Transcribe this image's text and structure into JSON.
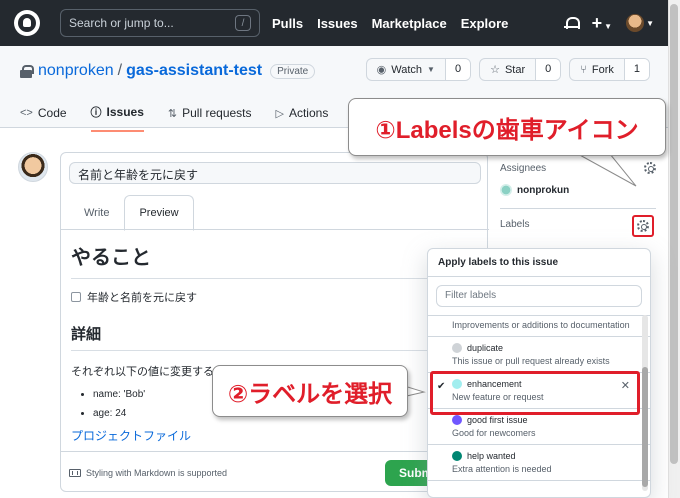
{
  "header": {
    "search_placeholder": "Search or jump to...",
    "search_key": "/",
    "nav": [
      "Pulls",
      "Issues",
      "Marketplace",
      "Explore"
    ],
    "plus": "+"
  },
  "repo": {
    "owner": "nonproken",
    "separator": "/",
    "name": "gas-assistant-test",
    "visibility": "Private",
    "watch_label": "Watch",
    "watch_count": "0",
    "star_label": "Star",
    "star_count": "0",
    "fork_label": "Fork",
    "fork_count": "1",
    "tabs": [
      {
        "label": "Code",
        "icon": "<>"
      },
      {
        "label": "Issues",
        "icon": "!"
      },
      {
        "label": "Pull requests",
        "icon": "pr"
      },
      {
        "label": "Actions",
        "icon": "play"
      }
    ],
    "accent_color": "#fd8c73"
  },
  "issue": {
    "title_value": "名前と年齢を元に戻す",
    "write_tab": "Write",
    "preview_tab": "Preview",
    "heading1": "やること",
    "task_item": "年齢と名前を元に戻す",
    "heading2": "詳細",
    "paragraph": "それぞれ以下の値に変更する。",
    "list": [
      "name: 'Bob'",
      "age: 24"
    ],
    "link": "プロジェクトファイル",
    "markdown_note": "Styling with Markdown is supported",
    "submit_label": "Submit new issue"
  },
  "sidebar": {
    "assignees_label": "Assignees",
    "assignee_name": "nonprokun",
    "labels_label": "Labels"
  },
  "labels_popup": {
    "title": "Apply labels to this issue",
    "filter_placeholder": "Filter labels",
    "items": [
      {
        "name": "",
        "description": "Improvements or additions to documentation",
        "color": "",
        "selected": false
      },
      {
        "name": "duplicate",
        "description": "This issue or pull request already exists",
        "color": "#cfd3d7",
        "selected": false
      },
      {
        "name": "enhancement",
        "description": "New feature or request",
        "color": "#a2eeef",
        "selected": true
      },
      {
        "name": "good first issue",
        "description": "Good for newcomers",
        "color": "#7057ff",
        "selected": false
      },
      {
        "name": "help wanted",
        "description": "Extra attention is needed",
        "color": "#008672",
        "selected": false
      }
    ]
  },
  "callouts": {
    "one": "①Labelsの歯車アイコン",
    "two": "②ラベルを選択",
    "color": "#e01e2a"
  }
}
